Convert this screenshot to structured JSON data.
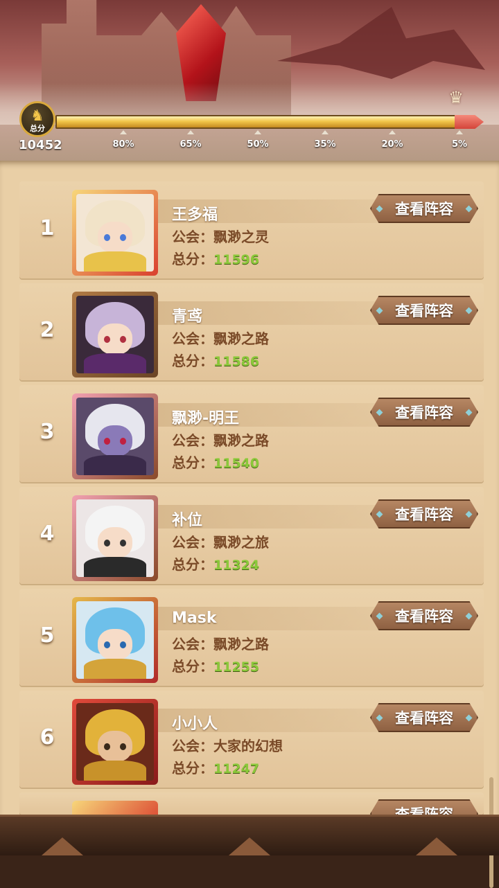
{
  "header": {
    "total_label": "总分",
    "total_value": "10452",
    "progress_ticks": [
      "80%",
      "65%",
      "50%",
      "35%",
      "20%",
      "5%"
    ]
  },
  "colors": {
    "score_green": "#8bc83a",
    "guild_brown": "#7a4a28",
    "button_brown": "#8e6142"
  },
  "list": {
    "guild_label": "公会：",
    "score_label": "总分：",
    "view_button_label": "查看阵容",
    "rows": [
      {
        "rank": "1",
        "name": "王多福",
        "guild": "飘渺之灵",
        "score": "11596"
      },
      {
        "rank": "2",
        "name": "青鸢",
        "guild": "飘渺之路",
        "score": "11586"
      },
      {
        "rank": "3",
        "name": "飘渺-明王",
        "guild": "飘渺之路",
        "score": "11540"
      },
      {
        "rank": "4",
        "name": "补位",
        "guild": "飘渺之旅",
        "score": "11324"
      },
      {
        "rank": "5",
        "name": "Mask",
        "guild": "飘渺之路",
        "score": "11255"
      },
      {
        "rank": "6",
        "name": "小小人",
        "guild": "大家的幻想",
        "score": "11247"
      }
    ],
    "partial_row": {
      "name": "...",
      "view_button_label": "查看阵容"
    }
  }
}
